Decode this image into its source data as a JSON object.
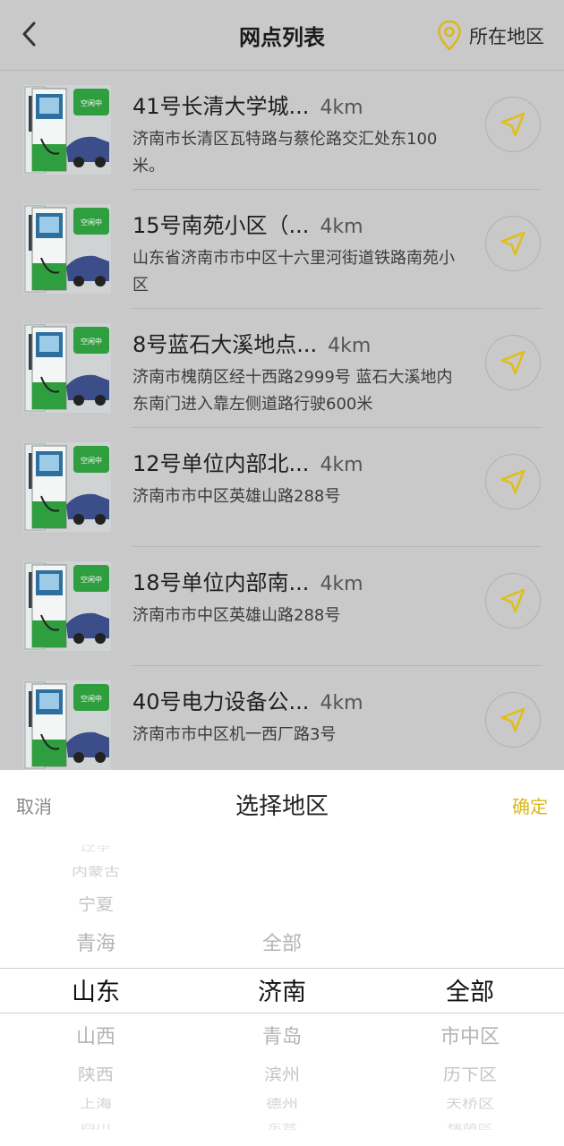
{
  "header": {
    "title": "网点列表",
    "region_label": "所在地区",
    "back_icon": "chevron-left-icon",
    "location_icon": "location-pin-icon"
  },
  "stations": [
    {
      "name": "41号长清大学城...",
      "distance": "4km",
      "address": "济南市长清区瓦特路与蔡伦路交汇处东100米。",
      "status": "空闲中"
    },
    {
      "name": "15号南苑小区（...",
      "distance": "4km",
      "address": "山东省济南市市中区十六里河街道铁路南苑小区",
      "status": "空闲中"
    },
    {
      "name": "8号蓝石大溪地点...",
      "distance": "4km",
      "address": "济南市槐荫区经十西路2999号  蓝石大溪地内   东南门进入靠左侧道路行驶600米",
      "status": "空闲中"
    },
    {
      "name": "12号单位内部北...",
      "distance": "4km",
      "address": "济南市市中区英雄山路288号",
      "status": "空闲中"
    },
    {
      "name": "18号单位内部南...",
      "distance": "4km",
      "address": "济南市市中区英雄山路288号",
      "status": "空闲中"
    },
    {
      "name": "40号电力设备公...",
      "distance": "4km",
      "address": "济南市市中区机一西厂路3号",
      "status": "空闲中"
    }
  ],
  "picker": {
    "cancel": "取消",
    "title": "选择地区",
    "confirm": "确定",
    "province": {
      "above": [
        "辽宁",
        "内蒙古",
        "宁夏",
        "青海"
      ],
      "selected": "山东",
      "below": [
        "山西",
        "陕西",
        "上海",
        "四川"
      ]
    },
    "city": {
      "above": [
        "全部"
      ],
      "selected": "济南",
      "below": [
        "青岛",
        "滨州",
        "德州",
        "东营"
      ]
    },
    "district": {
      "above": [],
      "selected": "全部",
      "below": [
        "市中区",
        "历下区",
        "天桥区",
        "槐荫区"
      ]
    }
  },
  "colors": {
    "accent": "#e0be1e",
    "overlay": "#c9c9c9",
    "charger_green": "#2f9e3e"
  }
}
